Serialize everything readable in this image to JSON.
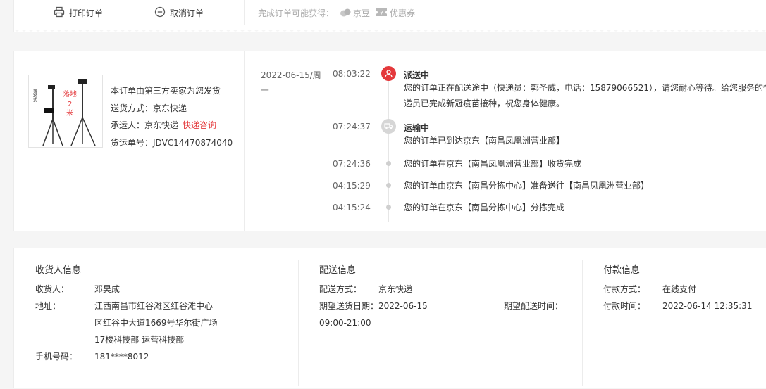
{
  "top": {
    "print_label": "打印订单",
    "cancel_label": "取消订单",
    "bonus_label": "完成订单可能获得：",
    "jingdou_label": "京豆",
    "coupon_label": "优惠券"
  },
  "shipment": {
    "seller_note": "本订单由第三方卖家为您发货",
    "delivery_method_label": "送货方式：",
    "delivery_method": "京东快递",
    "carrier_label": "承运人：",
    "carrier": "京东快递",
    "carrier_inquiry_link": "快递咨询",
    "waybill_label": "货运单号：",
    "waybill": "JDVC14470874040",
    "thumb_text_1": "落地",
    "thumb_text_2": "2",
    "thumb_text_3": "米",
    "thumb_side_text": "落地式"
  },
  "timeline": [
    {
      "date": "2022-06-15/周三",
      "time": "08:03:22",
      "status": "派送中",
      "message": "您的订单正在配送途中（快递员：郭圣威，电话：15879066521），请您耐心等待。给您服务的快递员已完成新冠疫苗接种，祝您身体健康。",
      "icon": "courier-icon"
    },
    {
      "date": "",
      "time": "07:24:37",
      "status": "运输中",
      "message": "您的订单已到达京东【南昌凤凰洲营业部】",
      "icon": "truck-icon"
    },
    {
      "date": "",
      "time": "07:24:36",
      "status": "",
      "message": "您的订单在京东【南昌凤凰洲营业部】收货完成",
      "icon": ""
    },
    {
      "date": "",
      "time": "04:15:29",
      "status": "",
      "message": "您的订单由京东【南昌分拣中心】准备送往【南昌凤凰洲营业部】",
      "icon": ""
    },
    {
      "date": "",
      "time": "04:15:24",
      "status": "",
      "message": "您的订单在京东【南昌分拣中心】分拣完成",
      "icon": ""
    }
  ],
  "receiver": {
    "title": "收货人信息",
    "name_label": "收货人：",
    "name": "邓昊成",
    "address_label": "地址：",
    "address_line1": "江西南昌市红谷滩区红谷滩中心",
    "address_line2": "区红谷中大道1669号华尔街广场",
    "address_line3": "17楼科技部 运营科技部",
    "phone_label": "手机号码：",
    "phone": "181****8012"
  },
  "delivery": {
    "title": "配送信息",
    "method_label": "配送方式：",
    "method": "京东快递",
    "expected_date_label": "期望送货日期：",
    "expected_date": "2022-06-15",
    "expected_time_label": "期望配送时间：",
    "time_window": "09:00-21:00"
  },
  "payment": {
    "title": "付款信息",
    "method_label": "付款方式：",
    "method": "在线支付",
    "time_label": "付款时间：",
    "time": "2022-06-14 12:35:31"
  },
  "colors": {
    "accent": "#e4393c",
    "muted": "#aaaaaa",
    "border": "#ececec"
  }
}
